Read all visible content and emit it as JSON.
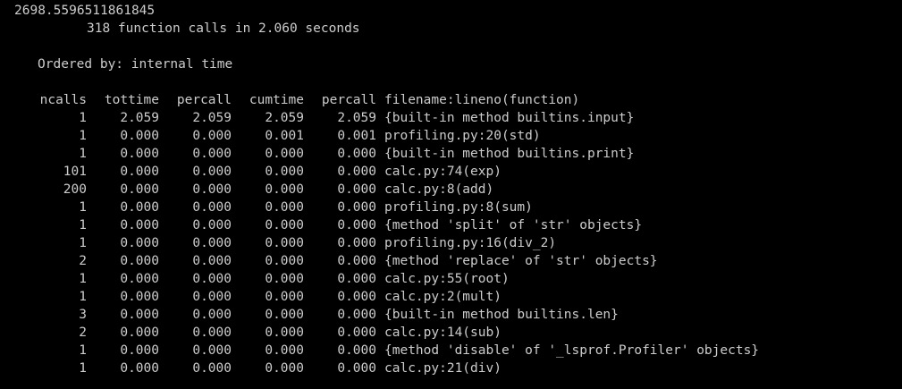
{
  "terminal": {
    "result": "2698.5596511861845",
    "summary": "318 function calls in 2.060 seconds",
    "ordered_by": "Ordered by: internal time",
    "headers": {
      "ncalls": "ncalls",
      "tottime": "tottime",
      "percall1": "percall",
      "cumtime": "cumtime",
      "percall2": "percall",
      "filename": "filename:lineno(function)"
    },
    "rows": [
      {
        "ncalls": "1",
        "tottime": "2.059",
        "percall1": "2.059",
        "cumtime": "2.059",
        "percall2": "2.059",
        "filename": "{built-in method builtins.input}"
      },
      {
        "ncalls": "1",
        "tottime": "0.000",
        "percall1": "0.000",
        "cumtime": "0.001",
        "percall2": "0.001",
        "filename": "profiling.py:20(std)"
      },
      {
        "ncalls": "1",
        "tottime": "0.000",
        "percall1": "0.000",
        "cumtime": "0.000",
        "percall2": "0.000",
        "filename": "{built-in method builtins.print}"
      },
      {
        "ncalls": "101",
        "tottime": "0.000",
        "percall1": "0.000",
        "cumtime": "0.000",
        "percall2": "0.000",
        "filename": "calc.py:74(exp)"
      },
      {
        "ncalls": "200",
        "tottime": "0.000",
        "percall1": "0.000",
        "cumtime": "0.000",
        "percall2": "0.000",
        "filename": "calc.py:8(add)"
      },
      {
        "ncalls": "1",
        "tottime": "0.000",
        "percall1": "0.000",
        "cumtime": "0.000",
        "percall2": "0.000",
        "filename": "profiling.py:8(sum)"
      },
      {
        "ncalls": "1",
        "tottime": "0.000",
        "percall1": "0.000",
        "cumtime": "0.000",
        "percall2": "0.000",
        "filename": "{method 'split' of 'str' objects}"
      },
      {
        "ncalls": "1",
        "tottime": "0.000",
        "percall1": "0.000",
        "cumtime": "0.000",
        "percall2": "0.000",
        "filename": "profiling.py:16(div_2)"
      },
      {
        "ncalls": "2",
        "tottime": "0.000",
        "percall1": "0.000",
        "cumtime": "0.000",
        "percall2": "0.000",
        "filename": "{method 'replace' of 'str' objects}"
      },
      {
        "ncalls": "1",
        "tottime": "0.000",
        "percall1": "0.000",
        "cumtime": "0.000",
        "percall2": "0.000",
        "filename": "calc.py:55(root)"
      },
      {
        "ncalls": "1",
        "tottime": "0.000",
        "percall1": "0.000",
        "cumtime": "0.000",
        "percall2": "0.000",
        "filename": "calc.py:2(mult)"
      },
      {
        "ncalls": "3",
        "tottime": "0.000",
        "percall1": "0.000",
        "cumtime": "0.000",
        "percall2": "0.000",
        "filename": "{built-in method builtins.len}"
      },
      {
        "ncalls": "2",
        "tottime": "0.000",
        "percall1": "0.000",
        "cumtime": "0.000",
        "percall2": "0.000",
        "filename": "calc.py:14(sub)"
      },
      {
        "ncalls": "1",
        "tottime": "0.000",
        "percall1": "0.000",
        "cumtime": "0.000",
        "percall2": "0.000",
        "filename": "{method 'disable' of '_lsprof.Profiler' objects}"
      },
      {
        "ncalls": "1",
        "tottime": "0.000",
        "percall1": "0.000",
        "cumtime": "0.000",
        "percall2": "0.000",
        "filename": "calc.py:21(div)"
      }
    ]
  },
  "colors": {
    "background": "#000000",
    "text": "#cccccc"
  }
}
